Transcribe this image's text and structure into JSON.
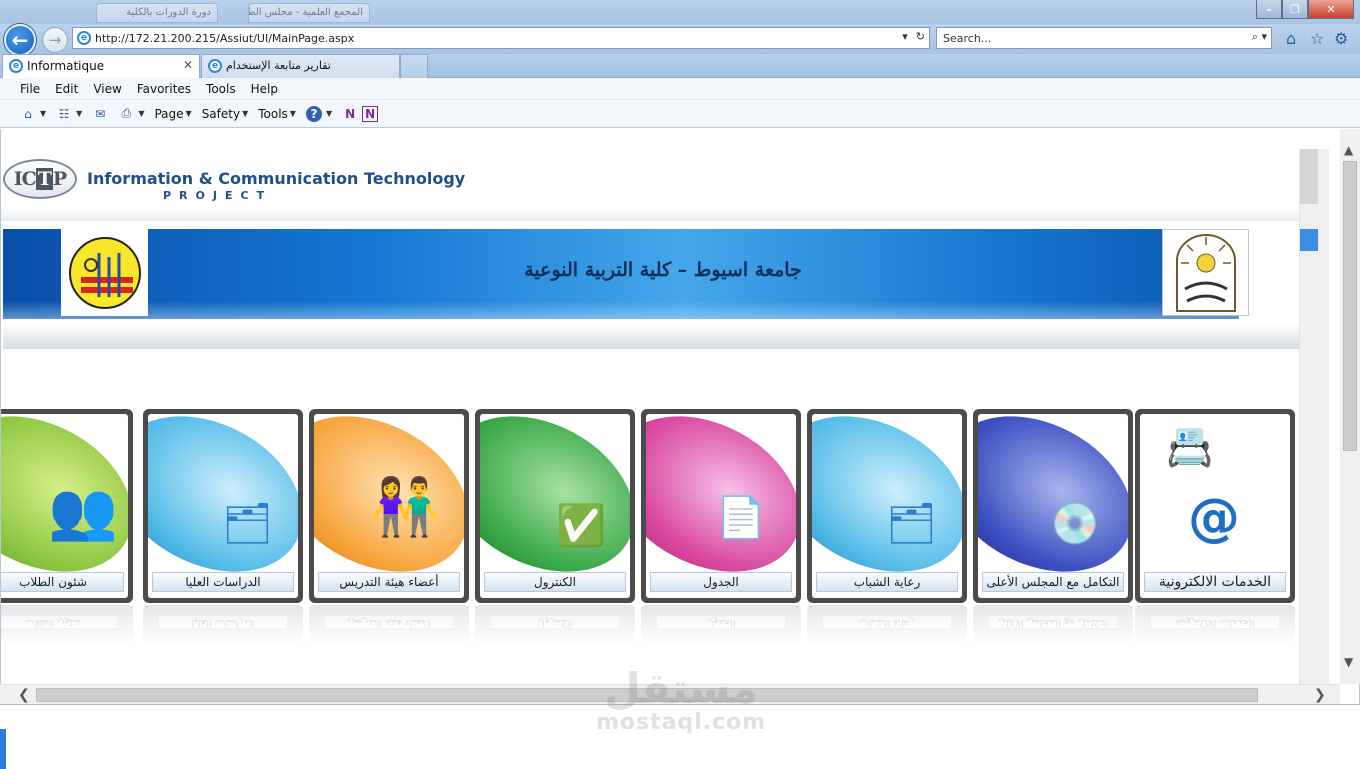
{
  "browser": {
    "address": "http://172.21.200.215/Assiut/UI/MainPage.aspx",
    "search_placeholder": "Search...",
    "tabs": [
      {
        "label": "Informatique",
        "active": true
      },
      {
        "label": "تقارير متابعة الإستخدام",
        "active": false
      }
    ],
    "background_tabs": [
      "دورة الدورات بالكلية",
      "المجمع العلمية - مجلس الطلاب"
    ],
    "menu": [
      "File",
      "Edit",
      "View",
      "Favorites",
      "Tools",
      "Help"
    ],
    "command_bar": {
      "page": "Page",
      "safety": "Safety",
      "tools": "Tools"
    }
  },
  "page": {
    "header": {
      "logo_text_a": "IC",
      "logo_text_b": "T",
      "logo_text_c": "P",
      "title": "Information & Communication Technology",
      "subtitle": "PROJECT"
    },
    "banner_title": "جامعة اسيوط – كلية التربية النوعية",
    "tiles": [
      {
        "label": "شئون الطلاب",
        "color": "#8cc63f",
        "icon": "students-icon"
      },
      {
        "label": "الدراسات العليا",
        "color": "#29a9e0",
        "icon": "folder-icon"
      },
      {
        "label": "أعضاء هيئة التدريس",
        "color": "#f7941d",
        "icon": "staff-icon"
      },
      {
        "label": "الكنترول",
        "color": "#2e9a3c",
        "icon": "calendar-check-icon"
      },
      {
        "label": "الجدول",
        "color": "#d4339b",
        "icon": "document-icon"
      },
      {
        "label": "رعاية الشباب",
        "color": "#29a9e0",
        "icon": "folder-icon"
      },
      {
        "label": "التكامل مع المجلس الأعلى",
        "color": "#2c3d9e",
        "icon": "disc-icon"
      },
      {
        "label": "الخدمات الالكترونية",
        "color": "#ffffff",
        "icon": "email-icon"
      }
    ]
  },
  "watermark": {
    "arabic": "مستقل",
    "latin": "mostaql.com"
  }
}
